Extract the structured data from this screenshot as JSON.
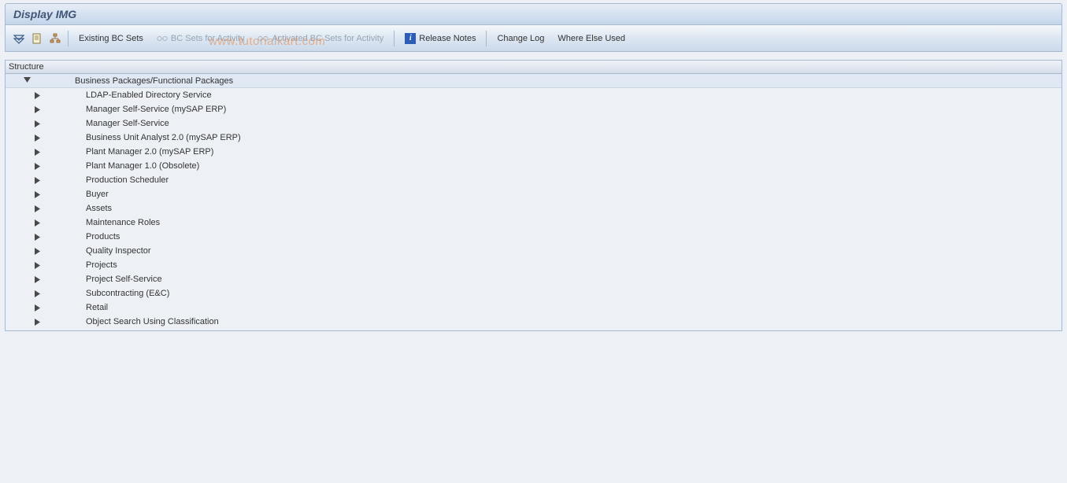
{
  "header": {
    "title": "Display IMG"
  },
  "toolbar": {
    "existing_bc_sets": "Existing BC Sets",
    "bc_sets_for_activity": "BC Sets for Activity",
    "activated_bc_sets_for_activity": "Activated BC Sets for Activity",
    "release_notes": "Release Notes",
    "change_log": "Change Log",
    "where_else_used": "Where Else Used"
  },
  "structure": {
    "header": "Structure",
    "root": "Business Packages/Functional Packages",
    "items": [
      "LDAP-Enabled Directory Service",
      "Manager Self-Service (mySAP ERP)",
      "Manager Self-Service",
      "Business Unit Analyst 2.0 (mySAP ERP)",
      "Plant Manager 2.0 (mySAP ERP)",
      "Plant Manager 1.0 (Obsolete)",
      "Production Scheduler",
      "Buyer",
      "Assets",
      "Maintenance Roles",
      "Products",
      "Quality Inspector",
      "Projects",
      "Project Self-Service",
      "Subcontracting (E&C)",
      "Retail",
      "Object Search Using Classification"
    ]
  },
  "watermark": "www.tutorialkart.com"
}
